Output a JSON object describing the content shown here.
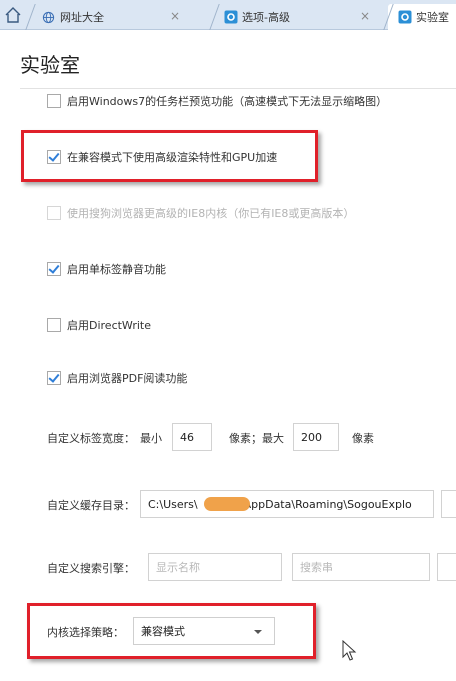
{
  "tabs": [
    {
      "label": "网址大全",
      "icon": "globe-icon"
    },
    {
      "label": "选项-高级",
      "icon": "settings-app-icon"
    },
    {
      "label": "实验室",
      "icon": "settings-app-icon"
    }
  ],
  "tab_close_glyph": "×",
  "page": {
    "title": "实验室"
  },
  "options": [
    {
      "label": "启用Windows7的任务栏预览功能（高速模式下无法显示缩略图）",
      "checked": false,
      "disabled": false
    },
    {
      "label": "在兼容模式下使用高级渲染特性和GPU加速",
      "checked": true,
      "disabled": false
    },
    {
      "label": "使用搜狗浏览器更高级的IE8内核（你已有IE8或更高版本）",
      "checked": false,
      "disabled": true
    },
    {
      "label": "启用单标签静音功能",
      "checked": true,
      "disabled": false
    },
    {
      "label": "启用DirectWrite",
      "checked": false,
      "disabled": false
    },
    {
      "label": "启用浏览器PDF阅读功能",
      "checked": true,
      "disabled": false
    }
  ],
  "tab_width": {
    "label": "自定义标签宽度：",
    "min_label": "最小",
    "min_value": "46",
    "max_label": "像素；最大",
    "max_value": "200",
    "unit": "像素"
  },
  "cache_dir": {
    "label": "自定义缓存目录：",
    "value_prefix": "C:\\Users\\",
    "value_suffix": "AppData\\Roaming\\SogouExplo"
  },
  "search_engine": {
    "label": "自定义搜索引擎：",
    "name_placeholder": "显示名称",
    "url_placeholder": "搜索串"
  },
  "kernel": {
    "label": "内核选择策略：",
    "selected": "兼容模式"
  },
  "colors": {
    "highlight": "#e0202a",
    "check": "#2f7ed8",
    "tabbar": "#dbe6f3"
  }
}
